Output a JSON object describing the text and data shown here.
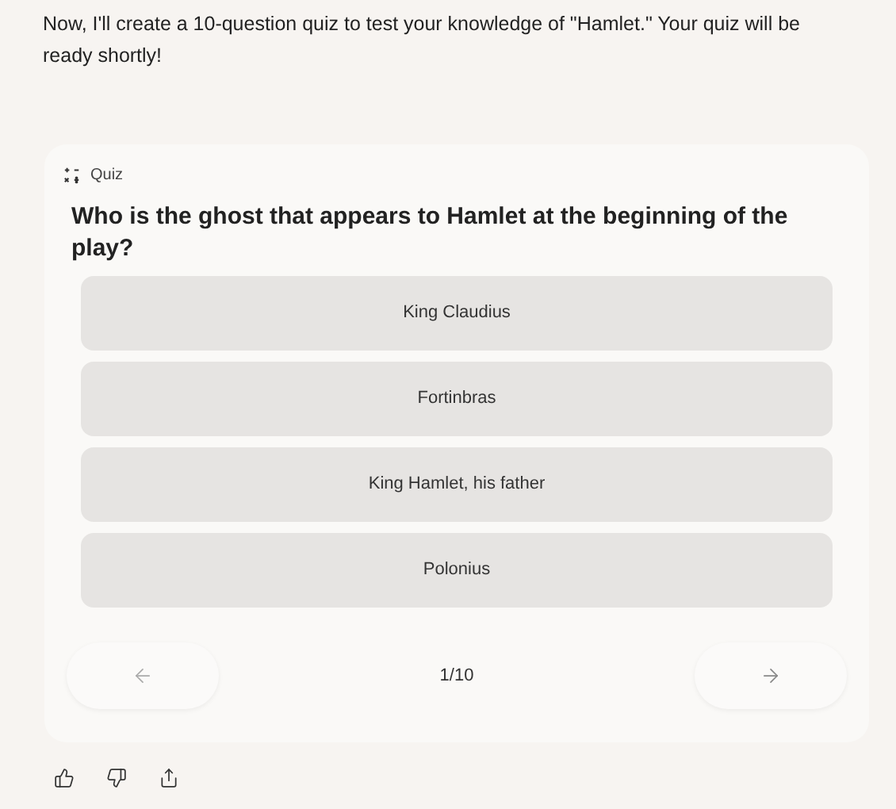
{
  "message": "Now, I'll create a 10-question quiz to test your knowledge of \"Hamlet.\" Your quiz will be ready shortly!",
  "quiz": {
    "label": "Quiz",
    "question": "Who is the ghost that appears to Hamlet at the beginning of the play?",
    "options": [
      {
        "label": "King Claudius"
      },
      {
        "label": "Fortinbras"
      },
      {
        "label": "King Hamlet, his father"
      },
      {
        "label": "Polonius"
      }
    ],
    "progress": "1/10"
  }
}
